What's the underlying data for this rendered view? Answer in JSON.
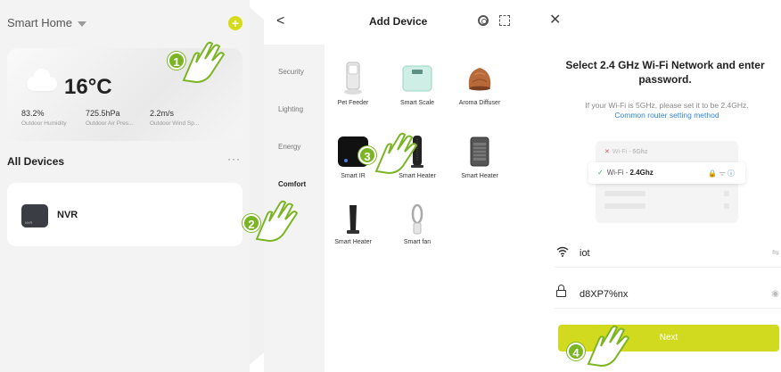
{
  "home": {
    "title": "Smart Home",
    "weather": {
      "temperature": "16°C",
      "humidity": "83.2%",
      "humidity_label": "Outdoor Humidity",
      "pressure": "725.5hPa",
      "pressure_label": "Outdoor Air Pres...",
      "wind": "2.2m/s",
      "wind_label": "Outdoor Wind Sp..."
    },
    "devices_heading": "All Devices",
    "more_label": "···",
    "device": {
      "name": "NVR",
      "icon_text": "NVR"
    }
  },
  "add_device": {
    "back_label": "<",
    "title": "Add Device",
    "categories": [
      "Security",
      "Lighting",
      "Energy",
      "Comfort"
    ],
    "active_category": "Comfort",
    "items": [
      {
        "label": "Pet Feeder",
        "icon": "pet-feeder-icon"
      },
      {
        "label": "Smart Scale",
        "icon": "scale-icon"
      },
      {
        "label": "Aroma Diffuser",
        "icon": "diffuser-icon"
      },
      {
        "label": "Smart IR",
        "icon": "ir-icon"
      },
      {
        "label": "Smart Heater",
        "icon": "tower-heater-icon"
      },
      {
        "label": "Smart Heater",
        "icon": "box-heater-icon"
      },
      {
        "label": "Smart Heater",
        "icon": "slim-heater-icon"
      },
      {
        "label": "Smart fan",
        "icon": "bladeless-fan-icon"
      }
    ]
  },
  "wifi": {
    "close_label": "✕",
    "title": "Select 2.4 GHz Wi-Fi Network and enter password.",
    "subtitle": "If your Wi-Fi is 5GHz, please set it to be 2.4GHz.",
    "link": "Common router setting method",
    "illus_5g_prefix": "Wi-Fi - ",
    "illus_5g": "5Ghz",
    "illus_24g_prefix": "Wi-Fi - ",
    "illus_24g": "2.4Ghz",
    "ssid": "iot",
    "password": "d8XP7%nx",
    "next_label": "Next"
  },
  "steps": [
    "1",
    "2",
    "3",
    "4"
  ],
  "colors": {
    "accent": "#d2da1f",
    "step": "#7ab523",
    "link": "#2f86d4"
  }
}
